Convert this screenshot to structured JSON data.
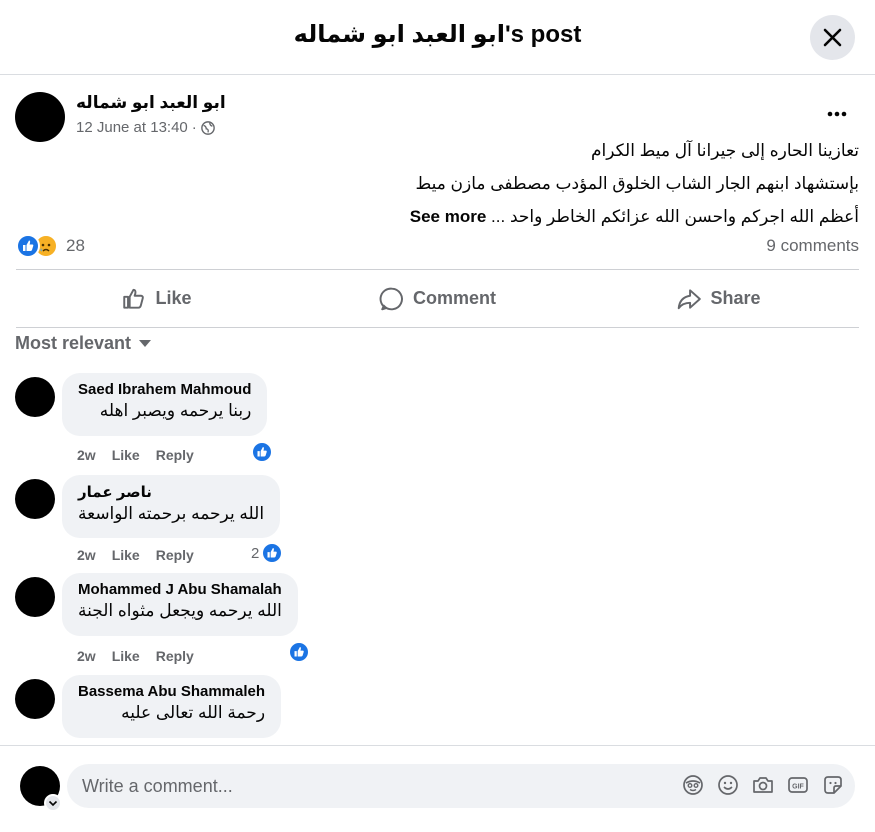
{
  "header": {
    "title": "ابو العبد ابو شماله's post",
    "close_icon": "close-icon"
  },
  "post": {
    "author": "ابو العبد ابو شماله",
    "timestamp": "12 June at 13:40",
    "separator": "·",
    "privacy_icon": "globe-icon",
    "lines": [
      "تعازينا الحاره إلى جيرانا آل ميط الكرام",
      "بإستشهاد ابنهم الجار الشاب الخلوق المؤدب مصطفى مازن ميط",
      "أعظم الله اجركم واحسن الله عزائكم الخاطر واحد ..."
    ],
    "see_more": "See more",
    "reaction_count": "28",
    "reaction_icons": [
      "like-icon",
      "sad-icon"
    ],
    "comments_count": "9 comments"
  },
  "actions": {
    "like": "Like",
    "comment": "Comment",
    "share": "Share"
  },
  "sort": {
    "label": "Most relevant"
  },
  "comments": [
    {
      "name": "Saed Ibrahem Mahmoud",
      "text": "ربنا يرحمه ويصبر اهله",
      "age": "2w",
      "like": "Like",
      "reply": "Reply",
      "likes": ""
    },
    {
      "name": "ناصر عمار",
      "text": "الله يرحمه برحمته الواسعة",
      "age": "2w",
      "like": "Like",
      "reply": "Reply",
      "likes": "2"
    },
    {
      "name": "Mohammed J Abu Shamalah",
      "text": "الله يرحمه ويجعل مثواه الجنة",
      "age": "2w",
      "like": "Like",
      "reply": "Reply",
      "likes": ""
    },
    {
      "name": "Bassema Abu Shammaleh",
      "text": "رحمة الله تعالى عليه",
      "age": "",
      "like": "",
      "reply": "",
      "likes": ""
    }
  ],
  "composer": {
    "placeholder": "Write a comment...",
    "icons": [
      "avatar-sticker-icon",
      "emoji-icon",
      "camera-icon",
      "gif-icon",
      "sticker-icon"
    ]
  },
  "colors": {
    "accent": "#1b74e4",
    "secondary_text": "#65676b",
    "bubble_bg": "#f0f2f5",
    "divider": "#ced0d4"
  }
}
